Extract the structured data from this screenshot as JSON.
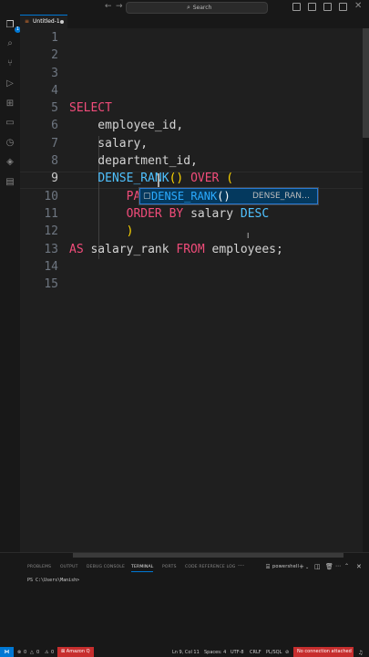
{
  "titlebar": {
    "back": "←",
    "forward": "→",
    "search_placeholder": "Search",
    "search_icon": "search-icon"
  },
  "tab": {
    "title": "Untitled-1",
    "icon": "sql-file-icon",
    "modified": true
  },
  "editor": {
    "line_numbers": [
      "1",
      "2",
      "3",
      "4",
      "5",
      "6",
      "7",
      "8",
      "9",
      "10",
      "11",
      "12",
      "13",
      "14",
      "15"
    ],
    "current_line": "9",
    "lines": {
      "l5": "SELECT",
      "l6": "    employee_id,",
      "l7": "    salary,",
      "l8": "    department_id,",
      "l9_fn": "DENSE_RANK",
      "l9_parens": "()",
      "l9_over": "OVER",
      "l9_open": "(",
      "l10_part": "PA",
      "l11_order": "ORDER BY",
      "l11_col": "salary",
      "l11_desc": "DESC",
      "l12": ")",
      "l13_as": "AS",
      "l13_alias": "salary_rank",
      "l13_from": "FROM",
      "l13_table": "employees;"
    }
  },
  "suggest": {
    "match": "DENSE_RANK",
    "rest": "()",
    "detail": "DENSE_RAN…",
    "icon": "function-cube-icon"
  },
  "panel": {
    "tabs": [
      "PROBLEMS",
      "OUTPUT",
      "DEBUG CONSOLE",
      "TERMINAL",
      "PORTS",
      "CODE REFERENCE LOG"
    ],
    "active_tab": "TERMINAL",
    "more": "···",
    "shell": "powershell",
    "prompt": "PS C:\\Users\\Manish>"
  },
  "statusbar": {
    "errors": "0",
    "warnings": "0",
    "info": "0",
    "amazonq": "Amazon Q",
    "position": "Ln 9, Col 11",
    "spaces": "Spaces: 4",
    "encoding": "UTF-8",
    "eol": "CRLF",
    "language": "PL/SQL",
    "connection": "No connection attached"
  },
  "colors": {
    "keyword": "#f14c7a",
    "function": "#4fc1ff",
    "accent": "#0078d4",
    "error_bg": "#c72e2e"
  }
}
